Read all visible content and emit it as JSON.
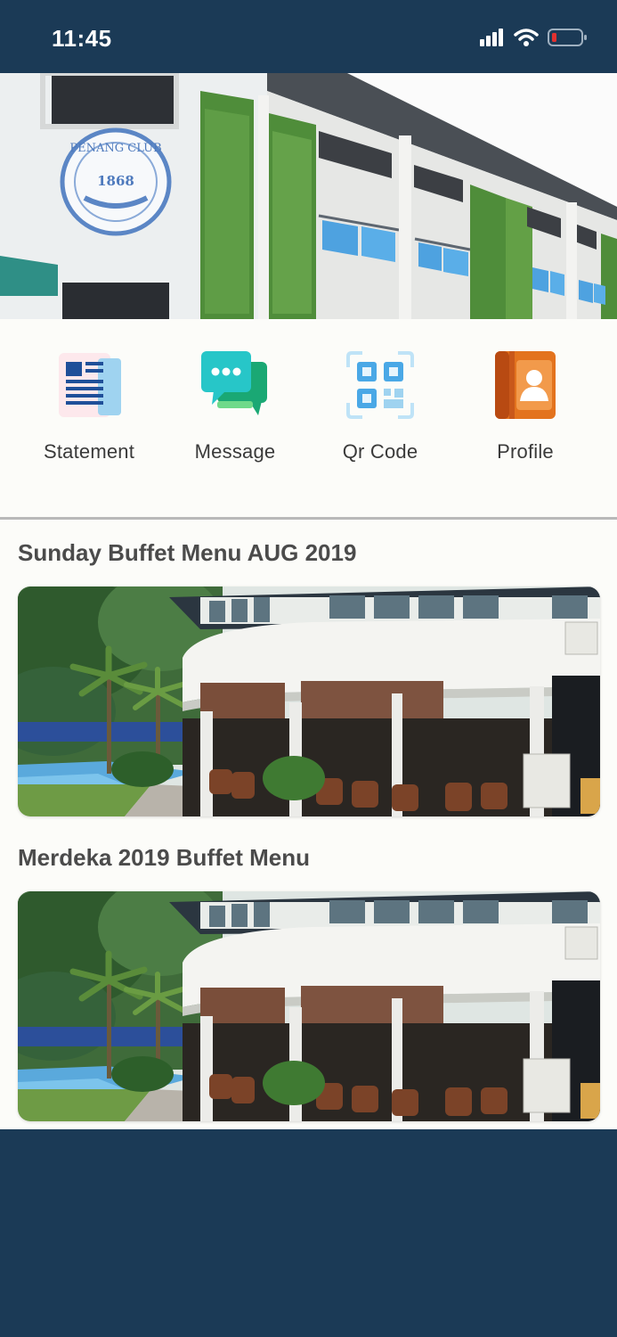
{
  "status_bar": {
    "time": "11:45",
    "icons": [
      "cellular-signal-icon",
      "wifi-icon",
      "battery-low-icon"
    ]
  },
  "hero": {
    "crest_name": "PENANG CLUB",
    "crest_year": "1868"
  },
  "quick_actions": [
    {
      "label": "Statement",
      "icon": "statement-document-icon"
    },
    {
      "label": "Message",
      "icon": "message-bubbles-icon"
    },
    {
      "label": "Qr Code",
      "icon": "qr-code-icon"
    },
    {
      "label": "Profile",
      "icon": "profile-contact-icon"
    }
  ],
  "news": [
    {
      "title": "Sunday Buffet Menu AUG 2019",
      "image": "clubhouse-pool-photo"
    },
    {
      "title": "Merdeka 2019 Buffet Menu",
      "image": "clubhouse-pool-photo"
    }
  ],
  "colors": {
    "brand_navy": "#1b3a56",
    "background": "#fcfcf9",
    "battery_low": "#e0312f"
  }
}
